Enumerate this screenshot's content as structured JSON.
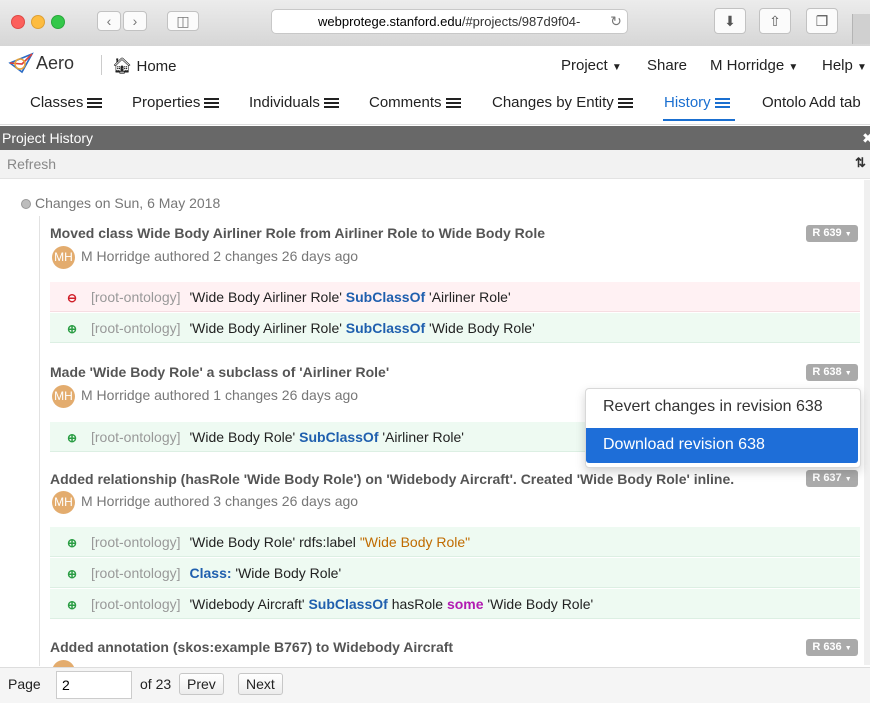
{
  "browser": {
    "url_domain": "webprotege.stanford.edu",
    "url_rest": "/#projects/987d9f04-"
  },
  "header": {
    "app_name": "Aero",
    "home_label": "Home",
    "project_label": "Project",
    "share_label": "Share",
    "user_label": "M Horridge",
    "help_label": "Help"
  },
  "tabs": [
    {
      "label": "Classes"
    },
    {
      "label": "Properties"
    },
    {
      "label": "Individuals"
    },
    {
      "label": "Comments"
    },
    {
      "label": "Changes by Entity"
    },
    {
      "label": "History"
    },
    {
      "label": "Ontolo"
    },
    {
      "label": "Add tab"
    }
  ],
  "portlet": {
    "title": "Project History",
    "refresh_label": "Refresh"
  },
  "day_header": "Changes on Sun, 6 May 2018",
  "changesets": [
    {
      "title": "Moved class Wide Body Airliner Role from Airliner Role to Wide Body Role",
      "revision": "R 639",
      "avatar": "MH",
      "author": "M Horridge authored 2 changes 26 days ago",
      "changes": [
        {
          "type": "remove",
          "ontology": "[root-ontology]",
          "parts": [
            "'Wide Body Airliner Role' ",
            "SubClassOf",
            " 'Airliner Role'"
          ]
        },
        {
          "type": "add",
          "ontology": "[root-ontology]",
          "parts": [
            "'Wide Body Airliner Role' ",
            "SubClassOf",
            " 'Wide Body Role'"
          ]
        }
      ]
    },
    {
      "title": "Made 'Wide Body Role' a subclass of 'Airliner Role'",
      "revision": "R 638",
      "avatar": "MH",
      "author": "M Horridge authored 1 changes 26 days ago",
      "changes": [
        {
          "type": "add",
          "ontology": "[root-ontology]",
          "parts": [
            "'Wide Body Role' ",
            "SubClassOf",
            " 'Airliner Role'"
          ]
        }
      ]
    },
    {
      "title": "Added relationship (hasRole 'Wide Body Role') on 'Widebody Aircraft'. Created 'Wide Body Role' inline.",
      "revision": "R 637",
      "avatar": "MH",
      "author": "M Horridge authored 3 changes 26 days ago",
      "changes": [
        {
          "type": "add",
          "ontology": "[root-ontology]",
          "parts": [
            "'Wide Body Role' rdfs:label ",
            "\"Wide Body Role\""
          ]
        },
        {
          "type": "add",
          "ontology": "[root-ontology]",
          "parts": [
            "Class:",
            " 'Wide Body Role'"
          ]
        },
        {
          "type": "add",
          "ontology": "[root-ontology]",
          "parts": [
            "'Widebody Aircraft' ",
            "SubClassOf",
            " hasRole ",
            "some",
            " 'Wide Body Role'"
          ]
        }
      ]
    },
    {
      "title": "Added annotation (skos:example B767) to Widebody Aircraft",
      "revision": "R 636"
    }
  ],
  "revision_menu": {
    "items": [
      "Revert changes in revision 638",
      "Download revision 638"
    ]
  },
  "pager": {
    "page_label": "Page",
    "page_value": "2",
    "of_label": "of 23",
    "prev_label": "Prev",
    "next_label": "Next"
  },
  "colors": {
    "accent": "#1a6fd0",
    "menu_highlight": "#1e6ed8",
    "added_bg": "#eefaf2",
    "removed_bg": "#fff1f3",
    "keyword": "#1f5fae",
    "literal": "#c06b00",
    "avatar": "#e3ac6e"
  }
}
